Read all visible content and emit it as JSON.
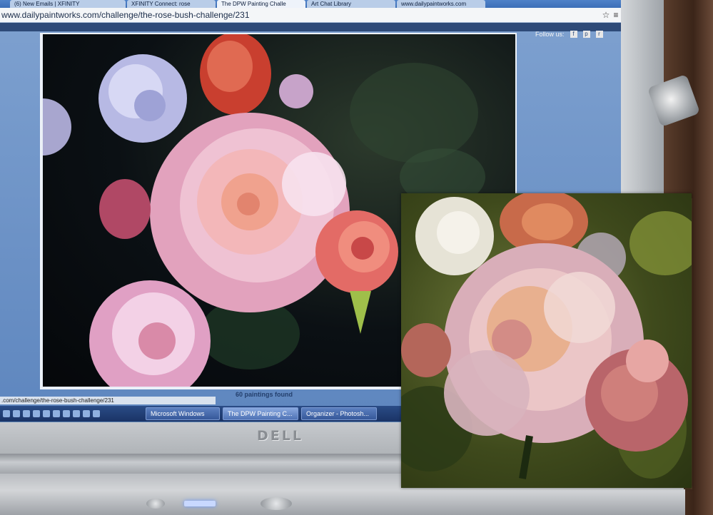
{
  "browser": {
    "tabs": [
      {
        "label": "(6) New Emails | XFINITY"
      },
      {
        "label": "XFINITY Connect: rose"
      },
      {
        "label": "The DPW Painting Challe"
      },
      {
        "label": "Art Chat Library"
      },
      {
        "label": "www.dailypaintworks.com"
      }
    ],
    "url": "www.dailypaintworks.com/challenge/the-rose-bush-challenge/231",
    "star_icon": "star-icon",
    "menu_icon": "menu-icon"
  },
  "page": {
    "follow_label": "Follow us:",
    "social_icons": [
      "facebook-icon",
      "pinterest-icon",
      "rss-icon"
    ],
    "results_text": "60 paintings found",
    "status_url": ".com/challenge/the-rose-bush-challenge/231"
  },
  "taskbar": {
    "items": [
      {
        "label": "Microsoft Windows"
      },
      {
        "label": "The DPW Painting C..."
      },
      {
        "label": "Organizer - Photosh..."
      }
    ]
  },
  "laptop": {
    "brand": "DELL"
  },
  "colors": {
    "screen_bg": "#5f86b6",
    "taskbar": "#1a3366",
    "rose_pink": "#e9a6b8",
    "coral": "#d86a5a",
    "painting_ground": "#4f5a24"
  }
}
